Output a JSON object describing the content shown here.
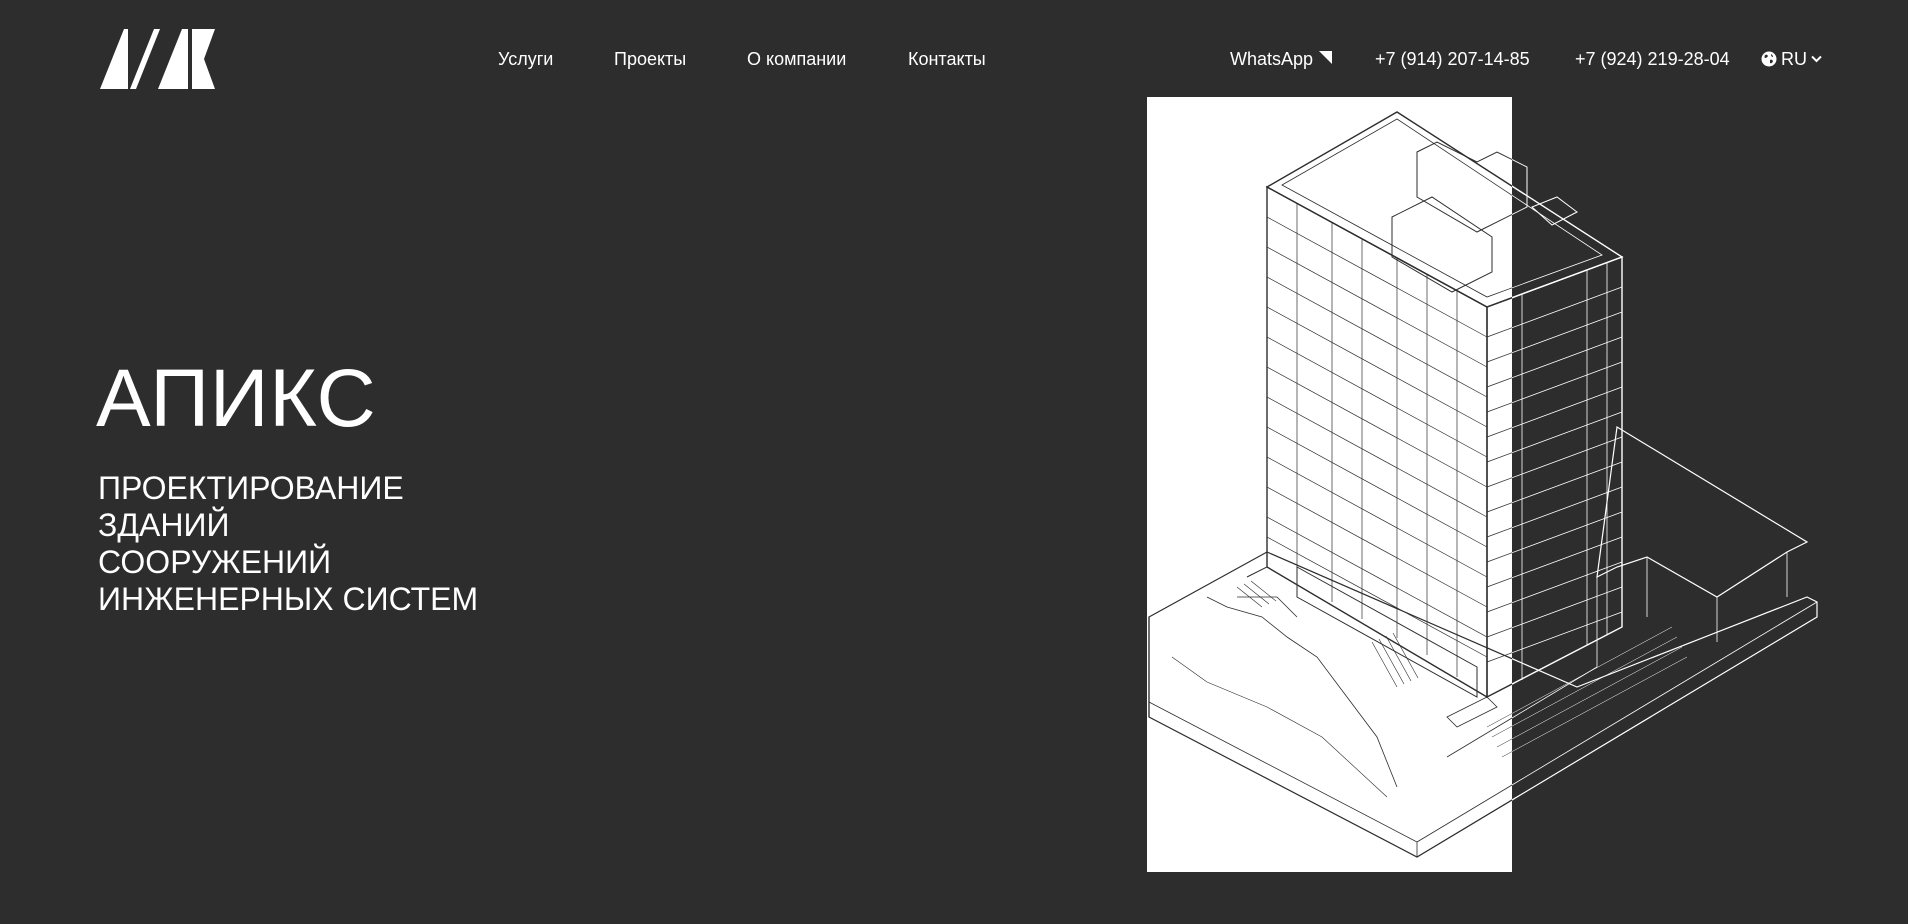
{
  "brand": {
    "logo_icon": "apiks-logo-icon"
  },
  "nav": {
    "items": [
      {
        "label": "Услуги"
      },
      {
        "label": "Проекты"
      },
      {
        "label": "О компании"
      },
      {
        "label": "Контакты"
      }
    ]
  },
  "contacts": {
    "whatsapp_label": "WhatsApp",
    "whatsapp_icon": "arrow-up-right-icon",
    "phone_1": "+7 (914) 207-14-85",
    "phone_2": "+7 (924) 219-28-04"
  },
  "language": {
    "current": "RU",
    "icon": "globe-icon",
    "caret_icon": "chevron-down-icon"
  },
  "hero": {
    "title": "АПИКС",
    "lines": [
      "ПРОЕКТИРОВАНИЕ",
      "ЗДАНИЙ",
      "СООРУЖЕНИЙ",
      "ИНЖЕНЕРНЫХ СИСТЕМ"
    ]
  },
  "colors": {
    "background": "#2d2d2d",
    "text": "#ffffff",
    "panel": "#ffffff"
  }
}
